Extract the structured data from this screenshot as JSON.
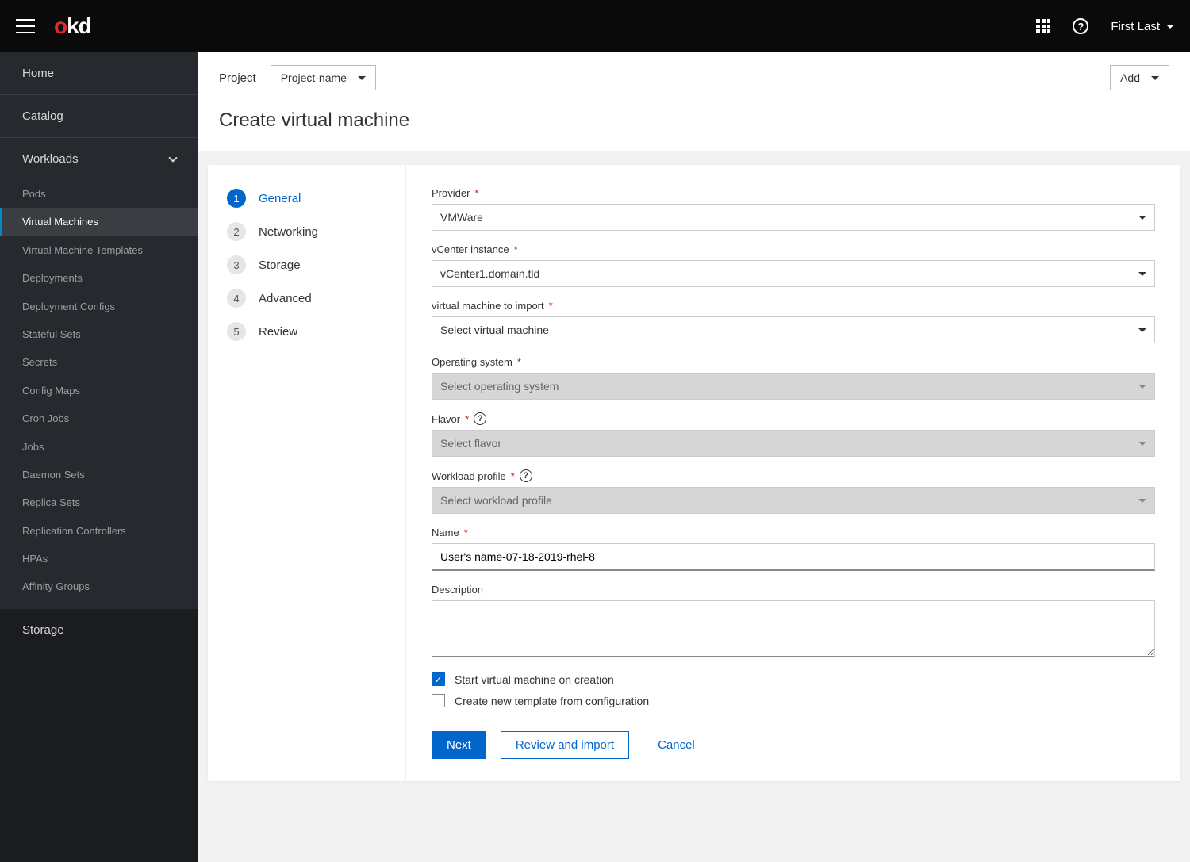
{
  "topbar": {
    "user_name": "First Last"
  },
  "sidebar": {
    "home": "Home",
    "catalog": "Catalog",
    "workloads": "Workloads",
    "storage": "Storage",
    "items": [
      "Pods",
      "Virtual Machines",
      "Virtual Machine Templates",
      "Deployments",
      "Deployment Configs",
      "Stateful Sets",
      "Secrets",
      "Config Maps",
      "Cron Jobs",
      "Jobs",
      "Daemon Sets",
      "Replica Sets",
      "Replication Controllers",
      "HPAs",
      "Affinity Groups"
    ]
  },
  "header": {
    "project_label": "Project",
    "project_value": "Project-name",
    "add_label": "Add",
    "title": "Create virtual machine"
  },
  "wizard": {
    "steps": [
      "General",
      "Networking",
      "Storage",
      "Advanced",
      "Review"
    ]
  },
  "form": {
    "provider": {
      "label": "Provider",
      "value": "VMWare"
    },
    "vcenter": {
      "label": "vCenter instance",
      "value": "vCenter1.domain.tld"
    },
    "import_vm": {
      "label": "virtual machine to import",
      "value": "Select virtual machine"
    },
    "os": {
      "label": "Operating system",
      "value": "Select operating system"
    },
    "flavor": {
      "label": "Flavor",
      "value": "Select flavor"
    },
    "workload": {
      "label": "Workload profile",
      "value": "Select workload profile"
    },
    "name": {
      "label": "Name",
      "value": "User's name-07-18-2019-rhel-8"
    },
    "description": {
      "label": "Description",
      "value": ""
    },
    "start_vm": "Start virtual machine on creation",
    "create_template": "Create new template from configuration",
    "btn_next": "Next",
    "btn_review": "Review and import",
    "btn_cancel": "Cancel"
  }
}
